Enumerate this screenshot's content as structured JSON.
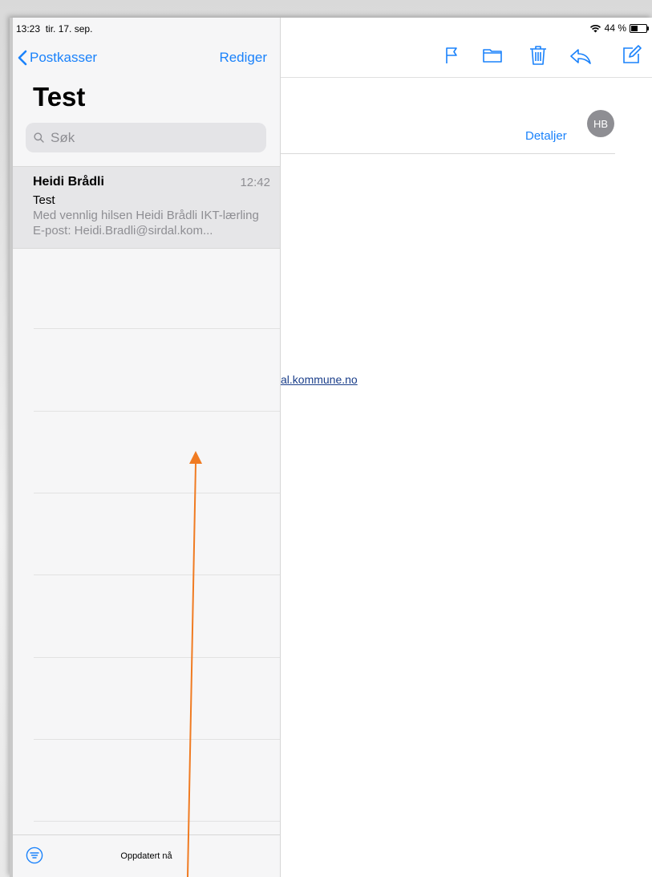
{
  "status_bar": {
    "time": "13:23",
    "date": "tir. 17. sep.",
    "battery": "44 %",
    "battery_level_percent": 44
  },
  "sidebar": {
    "back_label": "Postkasser",
    "edit_label": "Rediger",
    "title": "Test",
    "search": {
      "placeholder": "Søk"
    },
    "messages": [
      {
        "sender": "Heidi Brådli",
        "time": "12:42",
        "subject": "Test",
        "preview": "Med vennlig hilsen Heidi Brådli IKT-lærling E-post: Heidi.Bradli@sirdal.kom..."
      }
    ],
    "footer_status": "Oppdatert nå"
  },
  "main": {
    "toolbar": [
      "flag-icon",
      "folder-icon",
      "trash-icon",
      "reply-icon",
      "compose-icon"
    ],
    "avatar_initials": "HB",
    "details_label": "Detaljer",
    "body_link_fragment": "al.kommune.no"
  },
  "colors": {
    "accent": "#1a82fb",
    "annotation_arrow": "#f07b22",
    "avatar": "#8e8e93"
  }
}
